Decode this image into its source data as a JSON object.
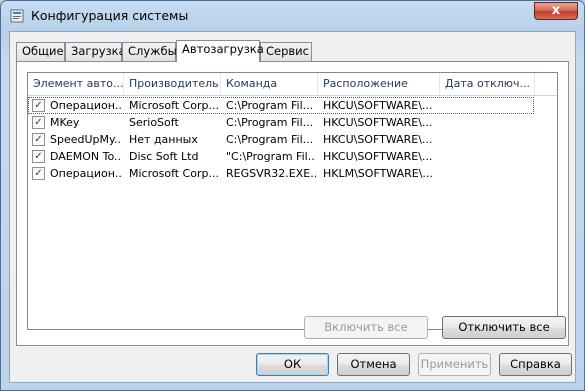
{
  "window": {
    "title": "Конфигурация системы",
    "close_glyph": "x"
  },
  "tabs": [
    {
      "label": "Общие"
    },
    {
      "label": "Загрузка"
    },
    {
      "label": "Службы"
    },
    {
      "label": "Автозагрузка",
      "active": true
    },
    {
      "label": "Сервис"
    }
  ],
  "table": {
    "columns": [
      "Элемент авто...",
      "Производитель",
      "Команда",
      "Расположение",
      "Дата отключ..."
    ],
    "rows": [
      {
        "checked": true,
        "item": "Операцион...",
        "maker": "Microsoft Corp...",
        "command": "C:\\Program Fil...",
        "location": "HKCU\\SOFTWARE\\...",
        "date": ""
      },
      {
        "checked": true,
        "item": "MKey",
        "maker": "SerioSoft",
        "command": "C:\\Program Fil...",
        "location": "HKCU\\SOFTWARE\\...",
        "date": ""
      },
      {
        "checked": true,
        "item": "SpeedUpMy...",
        "maker": "Нет данных",
        "command": "C:\\Program Fil...",
        "location": "HKCU\\SOFTWARE\\...",
        "date": ""
      },
      {
        "checked": true,
        "item": "DAEMON To...",
        "maker": "Disc Soft Ltd",
        "command": "\"C:\\Program Fil...",
        "location": "HKCU\\SOFTWARE\\...",
        "date": ""
      },
      {
        "checked": true,
        "item": "Операцион...",
        "maker": "Microsoft Corp...",
        "command": "REGSVR32.EXE...",
        "location": "HKLM\\SOFTWARE\\...",
        "date": ""
      }
    ]
  },
  "panel_buttons": {
    "enable_all": "Включить все",
    "disable_all": "Отключить все"
  },
  "dialog_buttons": {
    "ok": "ОК",
    "cancel": "Отмена",
    "apply": "Применить",
    "help": "Справка"
  }
}
